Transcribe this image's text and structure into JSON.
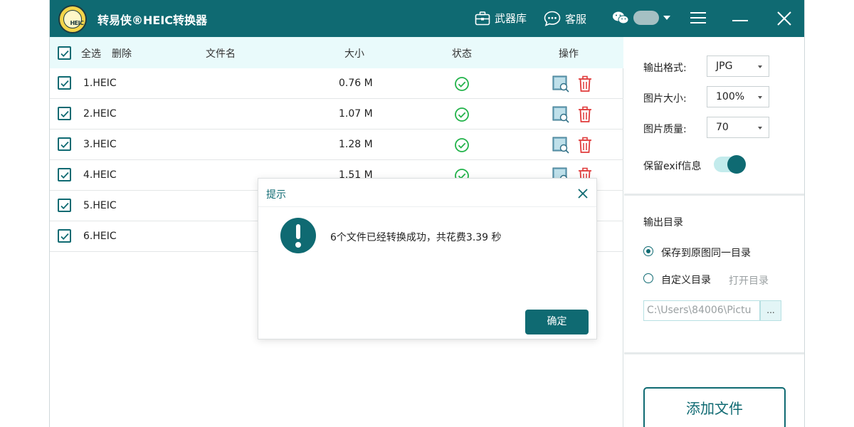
{
  "app": {
    "title": "转易侠®HEIC转换器",
    "logo_text": "HEIC",
    "accent_color": "#0f6a72"
  },
  "toolbar": {
    "tools_label": "武器库",
    "tools_icon": "briefcase-icon",
    "service_label": "客服",
    "service_icon": "chat-bubble-icon",
    "wechat_icon": "wechat-icon",
    "menu_icon": "hamburger-icon",
    "minimize_icon": "minimize-icon",
    "close_icon": "close-icon"
  },
  "table": {
    "select_all_label": "全选",
    "delete_label": "删除",
    "columns": {
      "name": "文件名",
      "size": "大小",
      "status": "状态",
      "actions": "操作"
    },
    "rows": [
      {
        "name": "1.HEIC",
        "size": "0.76 M",
        "checked": true,
        "status_icon": "check-circle-icon"
      },
      {
        "name": "2.HEIC",
        "size": "1.07 M",
        "checked": true,
        "status_icon": "check-circle-icon"
      },
      {
        "name": "3.HEIC",
        "size": "1.28 M",
        "checked": true,
        "status_icon": "check-circle-icon"
      },
      {
        "name": "4.HEIC",
        "size": "1.51 M",
        "checked": true,
        "status_icon": "check-circle-icon"
      },
      {
        "name": "5.HEIC",
        "size": "",
        "checked": true,
        "status_icon": ""
      },
      {
        "name": "6.HEIC",
        "size": "",
        "checked": true,
        "status_icon": ""
      }
    ]
  },
  "settings": {
    "format_label": "输出格式:",
    "format_value": "JPG",
    "size_label": "图片大小:",
    "size_value": "100%",
    "quality_label": "图片质量:",
    "quality_value": "70",
    "exif_label": "保留exif信息",
    "exif_enabled": true,
    "output_dir_label": "输出目录",
    "option_same_dir": "保存到原图同一目录",
    "option_custom_dir": "自定义目录",
    "open_dir_label": "打开目录",
    "path_value": "C:\\Users\\84006\\Pictu",
    "browse_label": "...",
    "add_files_label": "添加文件"
  },
  "dialog": {
    "title": "提示",
    "message": "6个文件已经转换成功，共花费3.39 秒",
    "ok_label": "确定"
  }
}
